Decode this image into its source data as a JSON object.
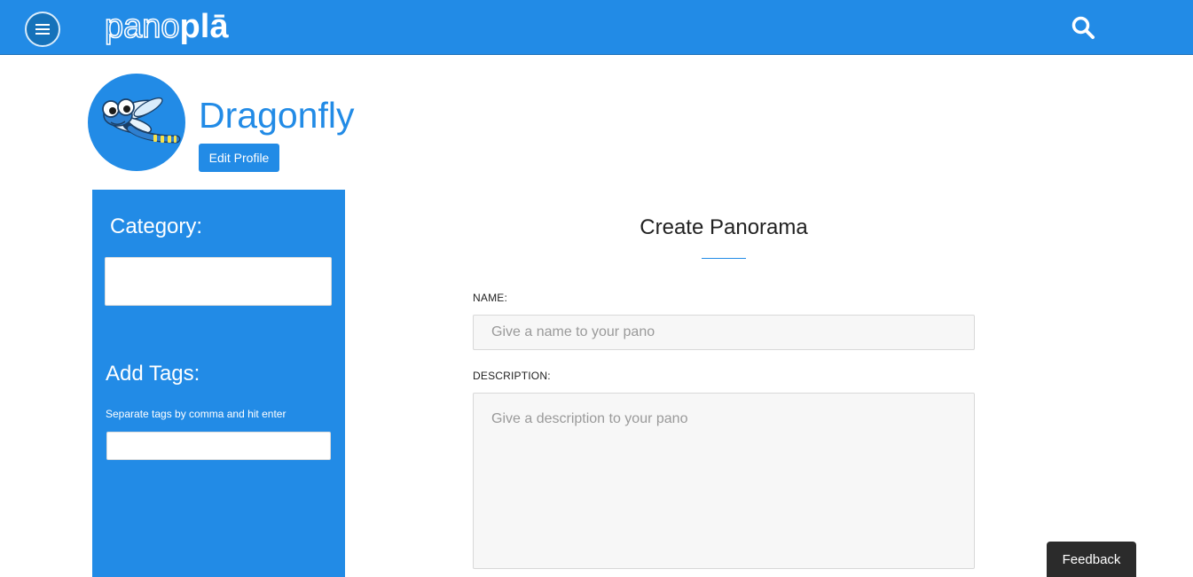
{
  "header": {
    "menu_icon": "hamburger-menu-icon",
    "logo_part_a": "pano",
    "logo_part_b": "plā",
    "search_icon": "search-icon",
    "bar_color": "#228be6"
  },
  "profile": {
    "name": "Dragonfly",
    "avatar_icon": "dragonfly-avatar",
    "edit_button_label": "Edit Profile"
  },
  "sidebar": {
    "category_label": "Category:",
    "tags_label": "Add Tags:",
    "tags_hint": "Separate tags by comma and hit enter",
    "background_color": "#228be6"
  },
  "form": {
    "title": "Create Panorama",
    "name_label": "NAME:",
    "name_placeholder": "Give a name to your pano",
    "description_label": "DESCRIPTION:",
    "description_placeholder": "Give a description to your pano"
  },
  "feedback": {
    "label": "Feedback"
  }
}
